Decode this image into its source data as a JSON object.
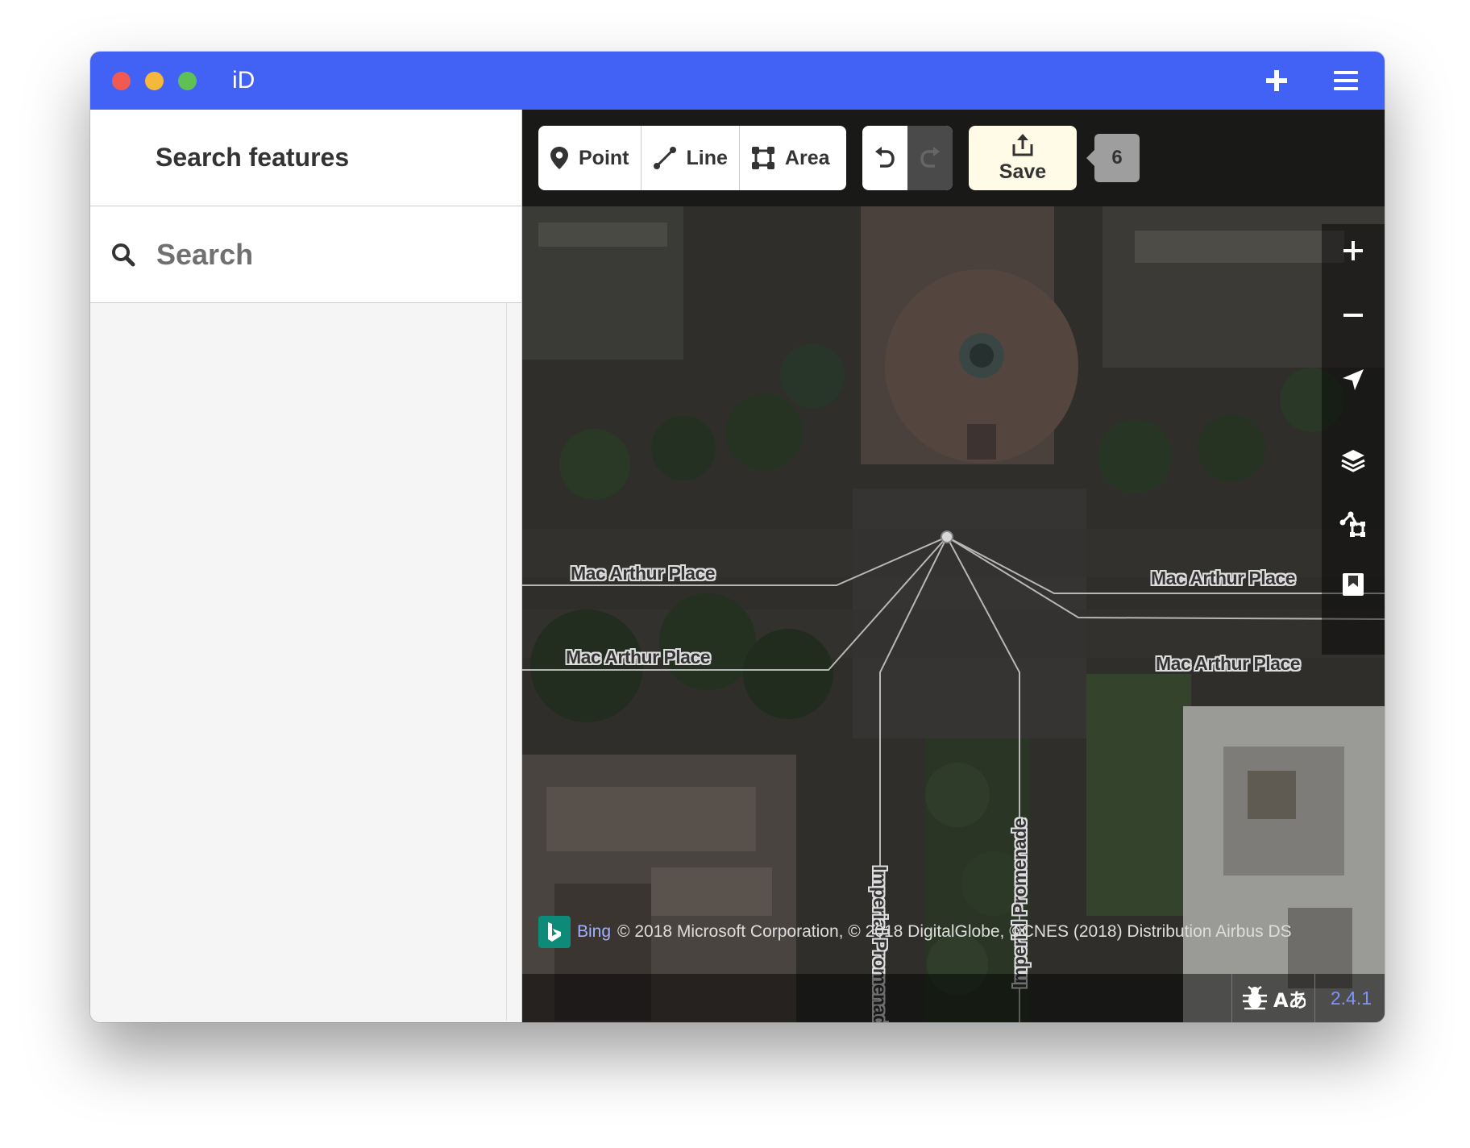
{
  "window": {
    "title": "iD"
  },
  "sidebar": {
    "header": "Search features",
    "search": {
      "placeholder": "Search",
      "value": ""
    }
  },
  "toolbar": {
    "modes": [
      {
        "label": "Point",
        "icon": "point-icon"
      },
      {
        "label": "Line",
        "icon": "line-icon"
      },
      {
        "label": "Area",
        "icon": "area-icon"
      }
    ],
    "undo": {
      "icon": "undo-icon",
      "enabled": true
    },
    "redo": {
      "icon": "redo-icon",
      "enabled": false
    },
    "save": {
      "label": "Save",
      "icon": "upload-icon",
      "count": "6"
    }
  },
  "map_controls": [
    {
      "name": "zoom-in",
      "icon": "plus-icon"
    },
    {
      "name": "zoom-out",
      "icon": "minus-icon"
    },
    {
      "name": "geolocate",
      "icon": "location-arrow-icon"
    },
    {
      "name": "background",
      "icon": "layers-icon"
    },
    {
      "name": "map-data",
      "icon": "data-icon"
    },
    {
      "name": "help",
      "icon": "help-book-icon"
    }
  ],
  "street_labels": [
    "Mac Arthur Place",
    "Mac Arthur Place",
    "Mac Arthur Place",
    "Mac Arthur Place",
    "Imperial Promenade",
    "Imperial Promenade"
  ],
  "attribution": {
    "provider": "Bing",
    "text": "© 2018 Microsoft Corporation, © 2018 DigitalGlobe, ©CNES (2018) Distribution Airbus DS"
  },
  "footer": {
    "version": "2.4.1",
    "icons": [
      "bug-icon",
      "translate-icon"
    ]
  },
  "colors": {
    "titlebar": "#4262f5",
    "save_background": "#fffbe6",
    "version_text": "#7f93ff",
    "bing_green": "#0d8a78"
  }
}
